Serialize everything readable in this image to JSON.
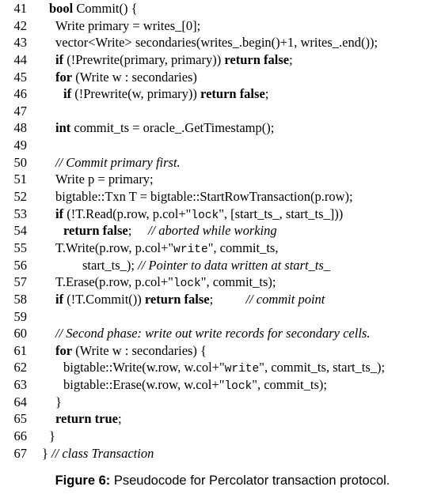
{
  "code_lines": [
    {
      "n": "41",
      "indent": 0,
      "segs": [
        {
          "t": "kw",
          "v": "bool"
        },
        {
          "t": "n",
          "v": " Commit() {"
        }
      ]
    },
    {
      "n": "42",
      "indent": 1,
      "segs": [
        {
          "t": "n",
          "v": "Write primary = writes_[0];"
        }
      ]
    },
    {
      "n": "43",
      "indent": 1,
      "segs": [
        {
          "t": "n",
          "v": "vector<Write> secondaries(writes_.begin()+1, writes_.end());"
        }
      ]
    },
    {
      "n": "44",
      "indent": 1,
      "segs": [
        {
          "t": "kw",
          "v": "if"
        },
        {
          "t": "n",
          "v": " (!Prewrite(primary, primary)) "
        },
        {
          "t": "kw",
          "v": "return false"
        },
        {
          "t": "n",
          "v": ";"
        }
      ]
    },
    {
      "n": "45",
      "indent": 1,
      "segs": [
        {
          "t": "kw",
          "v": "for"
        },
        {
          "t": "n",
          "v": " (Write w : secondaries)"
        }
      ]
    },
    {
      "n": "46",
      "indent": 2,
      "segs": [
        {
          "t": "kw",
          "v": "if"
        },
        {
          "t": "n",
          "v": " (!Prewrite(w, primary)) "
        },
        {
          "t": "kw",
          "v": "return false"
        },
        {
          "t": "n",
          "v": ";"
        }
      ]
    },
    {
      "n": "47",
      "indent": 0,
      "segs": []
    },
    {
      "n": "48",
      "indent": 1,
      "segs": [
        {
          "t": "kw",
          "v": "int"
        },
        {
          "t": "n",
          "v": " commit_ts = oracle_.GetTimestamp();"
        }
      ]
    },
    {
      "n": "49",
      "indent": 0,
      "segs": []
    },
    {
      "n": "50",
      "indent": 1,
      "segs": [
        {
          "t": "cm",
          "v": "// Commit primary first."
        }
      ]
    },
    {
      "n": "51",
      "indent": 1,
      "segs": [
        {
          "t": "n",
          "v": "Write p = primary;"
        }
      ]
    },
    {
      "n": "52",
      "indent": 1,
      "segs": [
        {
          "t": "n",
          "v": "bigtable::Txn T = bigtable::StartRowTransaction(p.row);"
        }
      ]
    },
    {
      "n": "53",
      "indent": 1,
      "segs": [
        {
          "t": "kw",
          "v": "if"
        },
        {
          "t": "n",
          "v": " (!T.Read(p.row, p.col+\""
        },
        {
          "t": "m",
          "v": "lock"
        },
        {
          "t": "n",
          "v": "\", [start_ts_, start_ts_]))"
        }
      ]
    },
    {
      "n": "54",
      "indent": 2,
      "segs": [
        {
          "t": "kw",
          "v": "return false"
        },
        {
          "t": "n",
          "v": ";     "
        },
        {
          "t": "cm",
          "v": "// aborted while working"
        }
      ]
    },
    {
      "n": "55",
      "indent": 1,
      "segs": [
        {
          "t": "n",
          "v": "T.Write(p.row, p.col+\""
        },
        {
          "t": "m",
          "v": "write"
        },
        {
          "t": "n",
          "v": "\", commit_ts,"
        }
      ]
    },
    {
      "n": "56",
      "indent": 3,
      "segs": [
        {
          "t": "n",
          "v": "start_ts_); "
        },
        {
          "t": "cm",
          "v": "// Pointer to data written at start_ts_"
        }
      ]
    },
    {
      "n": "57",
      "indent": 1,
      "segs": [
        {
          "t": "n",
          "v": "T.Erase(p.row, p.col+\""
        },
        {
          "t": "m",
          "v": "lock"
        },
        {
          "t": "n",
          "v": "\", commit_ts);"
        }
      ]
    },
    {
      "n": "58",
      "indent": 1,
      "segs": [
        {
          "t": "kw",
          "v": "if"
        },
        {
          "t": "n",
          "v": " (!T.Commit()) "
        },
        {
          "t": "kw",
          "v": "return false"
        },
        {
          "t": "n",
          "v": ";          "
        },
        {
          "t": "cm",
          "v": "// commit point"
        }
      ]
    },
    {
      "n": "59",
      "indent": 0,
      "segs": []
    },
    {
      "n": "60",
      "indent": 1,
      "segs": [
        {
          "t": "cm",
          "v": "// Second phase: write out write records for secondary cells."
        }
      ]
    },
    {
      "n": "61",
      "indent": 1,
      "segs": [
        {
          "t": "kw",
          "v": "for"
        },
        {
          "t": "n",
          "v": " (Write w : secondaries) {"
        }
      ]
    },
    {
      "n": "62",
      "indent": 2,
      "segs": [
        {
          "t": "n",
          "v": "bigtable::Write(w.row, w.col+\""
        },
        {
          "t": "m",
          "v": "write"
        },
        {
          "t": "n",
          "v": "\", commit_ts, start_ts_);"
        }
      ]
    },
    {
      "n": "63",
      "indent": 2,
      "segs": [
        {
          "t": "n",
          "v": "bigtable::Erase(w.row, w.col+\""
        },
        {
          "t": "m",
          "v": "lock"
        },
        {
          "t": "n",
          "v": "\", commit_ts);"
        }
      ]
    },
    {
      "n": "64",
      "indent": 1,
      "segs": [
        {
          "t": "n",
          "v": "}"
        }
      ]
    },
    {
      "n": "65",
      "indent": 1,
      "segs": [
        {
          "t": "kw",
          "v": "return true"
        },
        {
          "t": "n",
          "v": ";"
        }
      ]
    },
    {
      "n": "66",
      "indent": "0b",
      "segs": [
        {
          "t": "n",
          "v": "}"
        }
      ]
    },
    {
      "n": "67",
      "indent": "0c",
      "segs": [
        {
          "t": "n",
          "v": "} "
        },
        {
          "t": "cm",
          "v": "// class Transaction"
        }
      ]
    }
  ],
  "caption": {
    "label": "Figure 6:",
    "text": " Pseudocode for Percolator transaction protocol."
  }
}
